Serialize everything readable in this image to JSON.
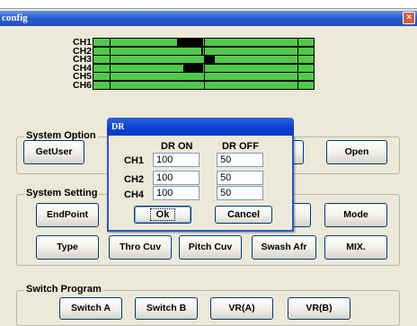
{
  "window": {
    "title": "config",
    "close_glyph": "×"
  },
  "channels": [
    {
      "label": "CH1",
      "fill_from": 0.38,
      "fill_to": 0.5
    },
    {
      "label": "CH2",
      "fill_from": 0.49,
      "fill_to": 0.5
    },
    {
      "label": "CH3",
      "fill_from": 0.5,
      "fill_to": 0.55
    },
    {
      "label": "CH4",
      "fill_from": 0.41,
      "fill_to": 0.5
    },
    {
      "label": "CH5",
      "fill_from": 0.5,
      "fill_to": 0.5
    },
    {
      "label": "CH6",
      "fill_from": 0.5,
      "fill_to": 0.5
    }
  ],
  "system_option": {
    "legend": "System Option",
    "getuser_label": "GetUser",
    "open_label": "Open"
  },
  "system_setting": {
    "legend": "System Setting",
    "endpoint_label": "EndPoint",
    "mode_label": "Mode",
    "type_label": "Type",
    "thro_cuv_label": "Thro Cuv",
    "pitch_cuv_label": "Pitch Cuv",
    "swash_afr_label": "Swash Afr",
    "mix_label": "MIX."
  },
  "switch_program": {
    "legend": "Switch Program",
    "switch_a_label": "Switch A",
    "switch_b_label": "Switch B",
    "vra_label": "VR(A)",
    "vrb_label": "VR(B)"
  },
  "dr_dialog": {
    "title": "DR",
    "col_on": "DR ON",
    "col_off": "DR OFF",
    "rows": [
      {
        "label": "CH1",
        "on": "100",
        "off": "50"
      },
      {
        "label": "CH2",
        "on": "100",
        "off": "50"
      },
      {
        "label": "CH4",
        "on": "100",
        "off": "50"
      }
    ],
    "ok_label": "Ok",
    "cancel_label": "Cancel"
  }
}
